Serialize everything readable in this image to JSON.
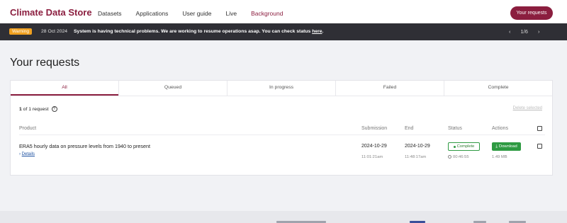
{
  "header": {
    "brand": "Climate Data Store",
    "nav": [
      "Datasets",
      "Applications",
      "User guide",
      "Live",
      "Background"
    ],
    "requests_button": "Your requests"
  },
  "banner": {
    "badge": "Warning",
    "date": "28 Oct 2024",
    "message": "System is having technical problems. We are working to resume operations asap. You can check status ",
    "link": "here",
    "suffix": ".",
    "page": "1/6",
    "prev_icon": "chevron-left-icon",
    "next_icon": "chevron-right-icon"
  },
  "page": {
    "title": "Your requests"
  },
  "tabs": [
    "All",
    "Queued",
    "In progress",
    "Failed",
    "Complete"
  ],
  "list": {
    "count_strong": "1",
    "count_rest": " of 1 request",
    "help_icon": "?",
    "delete_selected": "Delete selected",
    "columns": {
      "product": "Product",
      "submission": "Submission",
      "end": "End",
      "status": "Status",
      "actions": "Actions"
    }
  },
  "rows": [
    {
      "product": "ERA5 hourly data on pressure levels from 1940 to present",
      "details_chevron": "›",
      "details": "Details",
      "submission_date": "2024-10-29",
      "submission_time": "11:01:21am",
      "end_date": "2024-10-29",
      "end_time": "11:48:17am",
      "status": "Complete",
      "duration": "00:46:55",
      "download_icon": "⤓",
      "download": "Download",
      "size": "1.49 MB"
    }
  ],
  "colors": {
    "brand": "#8b1e3f",
    "success": "#2e9a42",
    "warning": "#f0a020",
    "banner_bg": "#2f2f35"
  }
}
